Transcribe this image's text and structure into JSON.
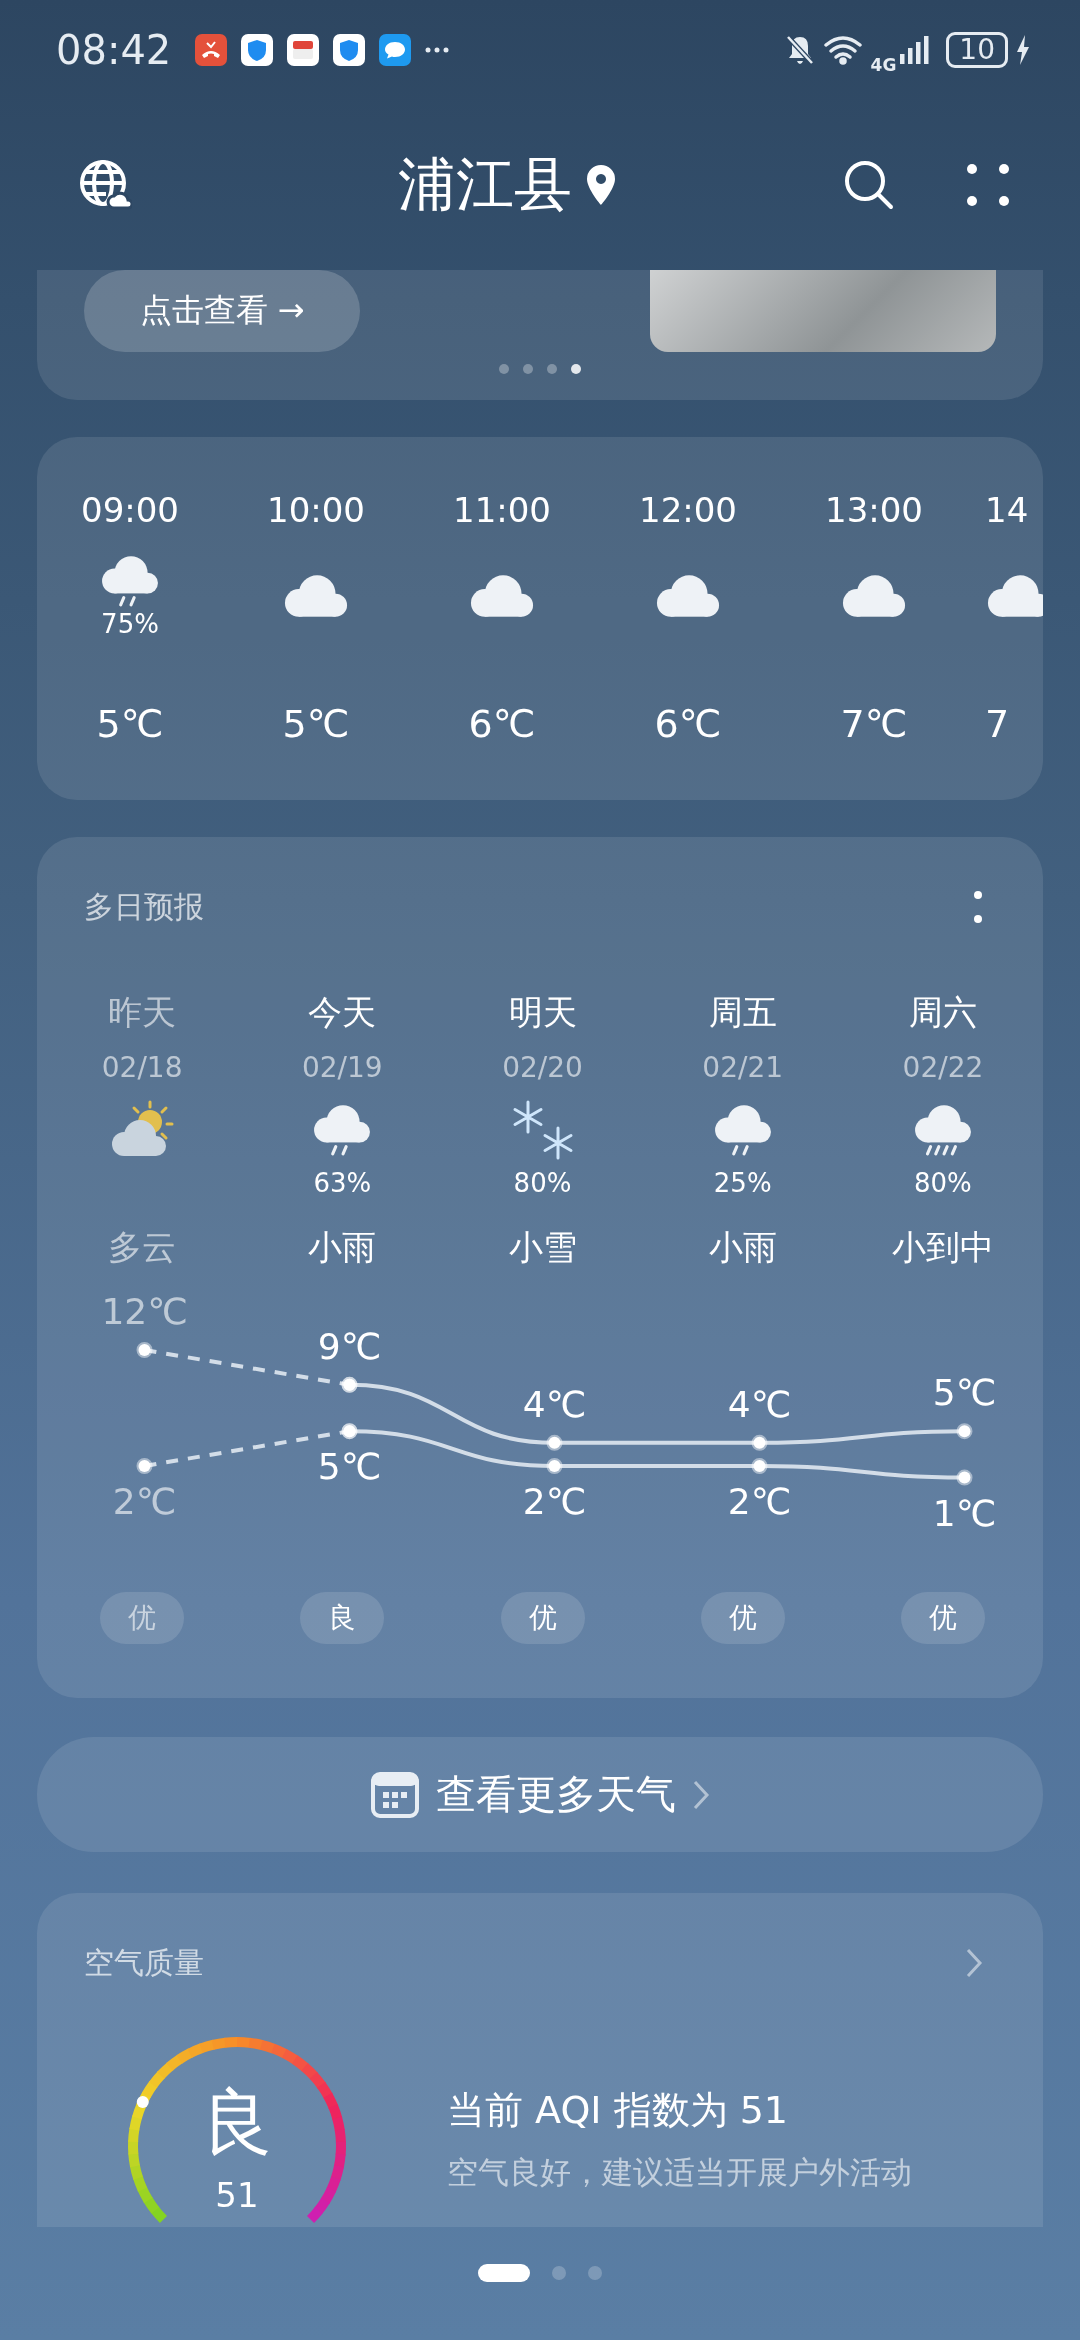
{
  "status_bar": {
    "time": "08:42",
    "notifications": [
      {
        "kind": "missed-call"
      },
      {
        "kind": "shield"
      },
      {
        "kind": "calendar"
      },
      {
        "kind": "shield"
      },
      {
        "kind": "message"
      }
    ],
    "network": "4G",
    "battery": "10",
    "charging": true
  },
  "header": {
    "title": "浦江县"
  },
  "banner": {
    "button": "点击查看 →",
    "pages": [
      {
        "selected": false
      },
      {
        "selected": false
      },
      {
        "selected": false
      },
      {
        "selected": true
      }
    ]
  },
  "hourly": [
    {
      "time": "09:00",
      "kind": "rain",
      "precip": "75%",
      "temp": "5℃"
    },
    {
      "time": "10:00",
      "kind": "cloudy",
      "temp": "5℃"
    },
    {
      "time": "11:00",
      "kind": "cloudy",
      "temp": "6℃"
    },
    {
      "time": "12:00",
      "kind": "cloudy",
      "temp": "6℃"
    },
    {
      "time": "13:00",
      "kind": "cloudy",
      "temp": "7℃"
    },
    {
      "time": "14",
      "kind": "cloudy",
      "temp": "7"
    }
  ],
  "daily": {
    "title": "多日预报",
    "days": [
      {
        "day": "昨天",
        "date": "02/18",
        "kind": "partly-cloudy",
        "condition": "多云",
        "past": true,
        "aqi": "优"
      },
      {
        "day": "今天",
        "date": "02/19",
        "kind": "rain",
        "precip": "63%",
        "condition": "小雨",
        "past": false,
        "aqi": "良"
      },
      {
        "day": "明天",
        "date": "02/20",
        "kind": "snow",
        "precip": "80%",
        "condition": "小雪",
        "past": false,
        "aqi": "优"
      },
      {
        "day": "周五",
        "date": "02/21",
        "kind": "rain",
        "precip": "25%",
        "condition": "小雨",
        "past": false,
        "aqi": "优"
      },
      {
        "day": "周六",
        "date": "02/22",
        "kind": "heavy-rain",
        "precip": "80%",
        "condition": "小到中",
        "past": false,
        "aqi": "优"
      }
    ],
    "chart_data": {
      "type": "line",
      "series": [
        {
          "color": "#d3dde8",
          "line_style": "dashed",
          "marker": "circle",
          "values": [
            12,
            9,
            null,
            null,
            null
          ],
          "value_labels": [
            "12℃",
            null,
            null,
            null,
            null
          ]
        },
        {
          "color": "#d3dde8",
          "line_style": "solid",
          "marker": "circle",
          "values": [
            null,
            9,
            4,
            4,
            5
          ],
          "value_labels": [
            null,
            "9℃",
            "4℃",
            "4℃",
            "5℃"
          ]
        },
        {
          "color": "#d3dde8",
          "line_style": "dashed",
          "marker": "circle",
          "values": [
            2,
            5,
            null,
            null,
            null
          ],
          "value_labels": [
            "2℃",
            null,
            null,
            null,
            null
          ]
        },
        {
          "color": "#d3dde8",
          "line_style": "solid",
          "marker": "circle",
          "values": [
            null,
            5,
            2,
            2,
            1
          ],
          "value_labels": [
            null,
            "5℃",
            "2℃",
            "2℃",
            "1℃"
          ]
        }
      ]
    }
  },
  "more_button": "查看更多天气",
  "air_quality": {
    "title": "空气质量",
    "grade": "良",
    "index": "51",
    "headline": "当前 AQI 指数为 51",
    "advice": "空气良好，建议适当开展户外活动"
  },
  "pager": [
    {
      "selected": true
    },
    {
      "selected": false
    },
    {
      "selected": false
    }
  ]
}
